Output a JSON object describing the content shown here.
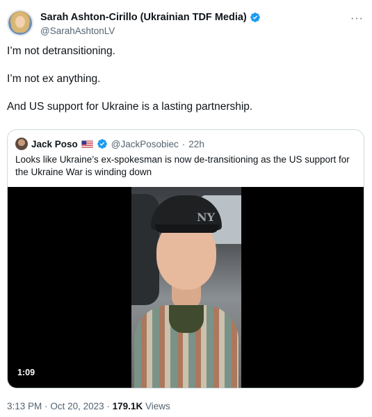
{
  "author": {
    "display_name": "Sarah Ashton-Cirillo (Ukrainian TDF Media)",
    "handle": "@SarahAshtonLV",
    "more_icon": "more-horizontal-icon"
  },
  "body": {
    "lines": [
      "I’m not detransitioning.",
      "I’m not ex anything.",
      "And US support for Ukraine is a lasting partnership."
    ]
  },
  "quote": {
    "display_name": "Jack Poso",
    "handle": "@JackPosobiec",
    "separator": "·",
    "time": "22h",
    "text": "Looks like Ukraine’s ex-spokesman is now de-transitioning as the US support for the Ukraine War is winding down",
    "video": {
      "duration": "1:09",
      "cap_logo": "NY"
    }
  },
  "meta": {
    "time": "3:13 PM",
    "separator": "·",
    "date": "Oct 20, 2023",
    "views_count": "179.1K",
    "views_label": "Views"
  },
  "colors": {
    "verified": "#1d9bf0",
    "secondary_text": "#536471",
    "border": "#cfd9de"
  }
}
